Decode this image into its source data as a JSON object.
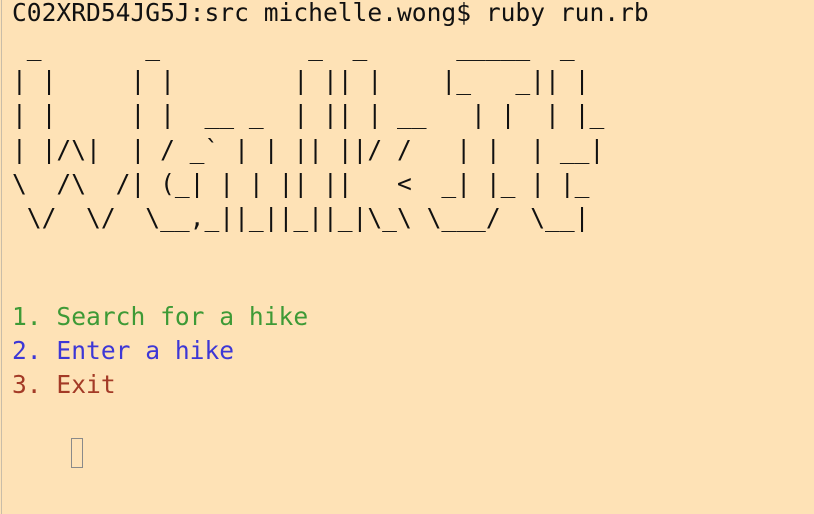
{
  "terminal": {
    "prompt": "C02XRD54JG5J:src michelle.wong$ ruby run.rb",
    "banner": " _       _          _  _      _____  _\n| |     | |        | || |    |_   _|| |\n| |     | |  __ _  | || | __   | |  | |_\n| |/\\|  | / _` | | || ||/ /   | |  | __|\n\\  /\\  /| (_| | | || ||   <  _| |_ | |_\n \\/  \\/  \\__,_||_||_||_|\\_\\ \\___/  \\__|",
    "menu": [
      {
        "label": "1. Search for a hike",
        "color": "#3E9A36"
      },
      {
        "label": "2. Enter a hike",
        "color": "#3D37D6"
      },
      {
        "label": "3. Exit",
        "color": "#A33A26"
      }
    ]
  }
}
